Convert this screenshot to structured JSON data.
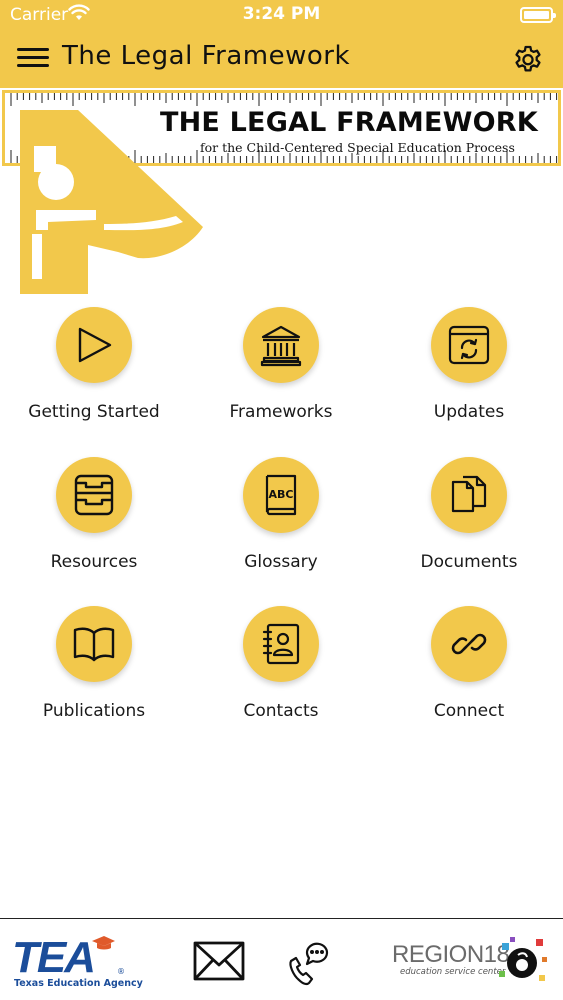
{
  "status_bar": {
    "carrier": "Carrier",
    "time": "3:24 PM"
  },
  "nav": {
    "title": "The Legal Framework",
    "menu_icon": "hamburger-menu-icon",
    "settings_icon": "gear-icon"
  },
  "banner": {
    "headline": "THE LEGAL FRAMEWORK",
    "subtitle": "for the Child-Centered Special Education Process"
  },
  "tiles": [
    {
      "label": "Getting Started",
      "icon": "play-icon"
    },
    {
      "label": "Frameworks",
      "icon": "bank-building-icon"
    },
    {
      "label": "Updates",
      "icon": "refresh-window-icon"
    },
    {
      "label": "Resources",
      "icon": "inbox-tray-icon"
    },
    {
      "label": "Glossary",
      "icon": "abc-book-icon"
    },
    {
      "label": "Documents",
      "icon": "documents-icon"
    },
    {
      "label": "Publications",
      "icon": "open-book-icon"
    },
    {
      "label": "Contacts",
      "icon": "address-book-icon"
    },
    {
      "label": "Connect",
      "icon": "link-icon"
    }
  ],
  "footer": {
    "tea_logo": "TEA",
    "tea_agency": "Texas Education Agency",
    "mail_icon": "envelope-icon",
    "phone_icon": "phone-chat-icon",
    "region_name": "REGION18",
    "region_sub": "education service center"
  },
  "colors": {
    "accent": "#f2c84b",
    "tea_blue": "#1b4d9a",
    "text": "#111111"
  }
}
